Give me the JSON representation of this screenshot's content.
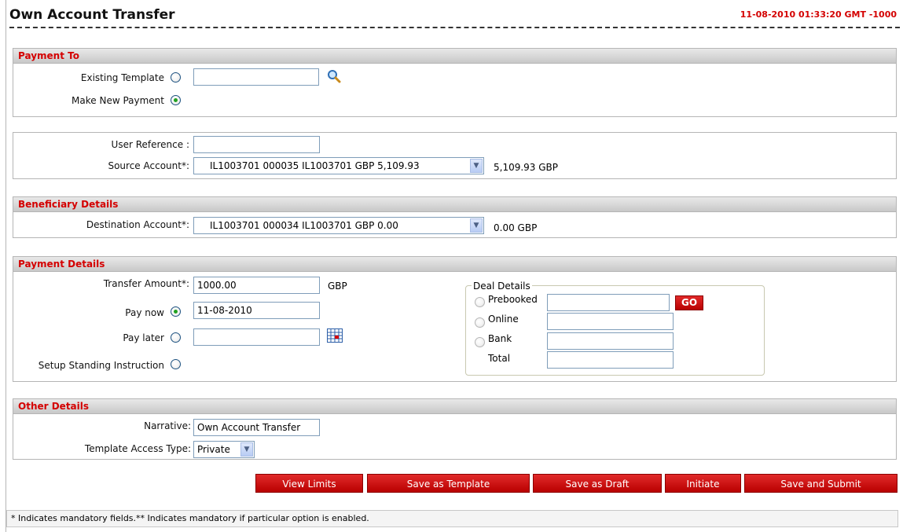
{
  "header": {
    "title": "Own Account Transfer",
    "datetime": "11-08-2010 01:33:20 GMT -1000"
  },
  "payment_to": {
    "heading": "Payment To",
    "existing_template_label": "Existing Template",
    "existing_template_value": "",
    "make_new_payment_label": "Make New Payment",
    "selected": "make_new_payment"
  },
  "account": {
    "user_reference_label": "User Reference :",
    "user_reference_value": "",
    "source_account_label": "Source Account*:",
    "source_account_value": "IL1003701 000035 IL1003701 GBP 5,109.93",
    "source_balance": "5,109.93 GBP"
  },
  "beneficiary": {
    "heading": "Beneficiary Details",
    "destination_label": "Destination Account*:",
    "destination_value": "IL1003701 000034 IL1003701 GBP 0.00",
    "destination_balance": "0.00 GBP"
  },
  "payment_details": {
    "heading": "Payment Details",
    "transfer_amount_label": "Transfer Amount*:",
    "transfer_amount_value": "1000.00",
    "currency": "GBP",
    "pay_now_label": "Pay now",
    "pay_now_date": "11-08-2010",
    "pay_later_label": "Pay later",
    "pay_later_date": "",
    "standing_instruction_label": "Setup Standing Instruction",
    "selected": "pay_now",
    "deal_details": {
      "legend": "Deal Details",
      "prebooked_label": "Prebooked",
      "online_label": "Online",
      "bank_label": "Bank",
      "total_label": "Total",
      "go_label": "GO"
    }
  },
  "other_details": {
    "heading": "Other Details",
    "narrative_label": "Narrative:",
    "narrative_value": "Own Account Transfer",
    "template_access_label": "Template Access Type:",
    "template_access_value": "Private"
  },
  "actions": {
    "view_limits": "View Limits",
    "save_as_template": "Save as Template",
    "save_as_draft": "Save as Draft",
    "initiate": "Initiate",
    "save_and_submit": "Save and Submit"
  },
  "footer": {
    "note": "* Indicates mandatory fields.** Indicates mandatory if particular option is enabled."
  },
  "colors": {
    "accent_red": "#d40000",
    "button_red": "#c40000",
    "radio_checked": "#21a121"
  },
  "icons": {
    "search": "search-icon",
    "calendar": "calendar-icon",
    "dropdown": "chevron-down-icon"
  }
}
